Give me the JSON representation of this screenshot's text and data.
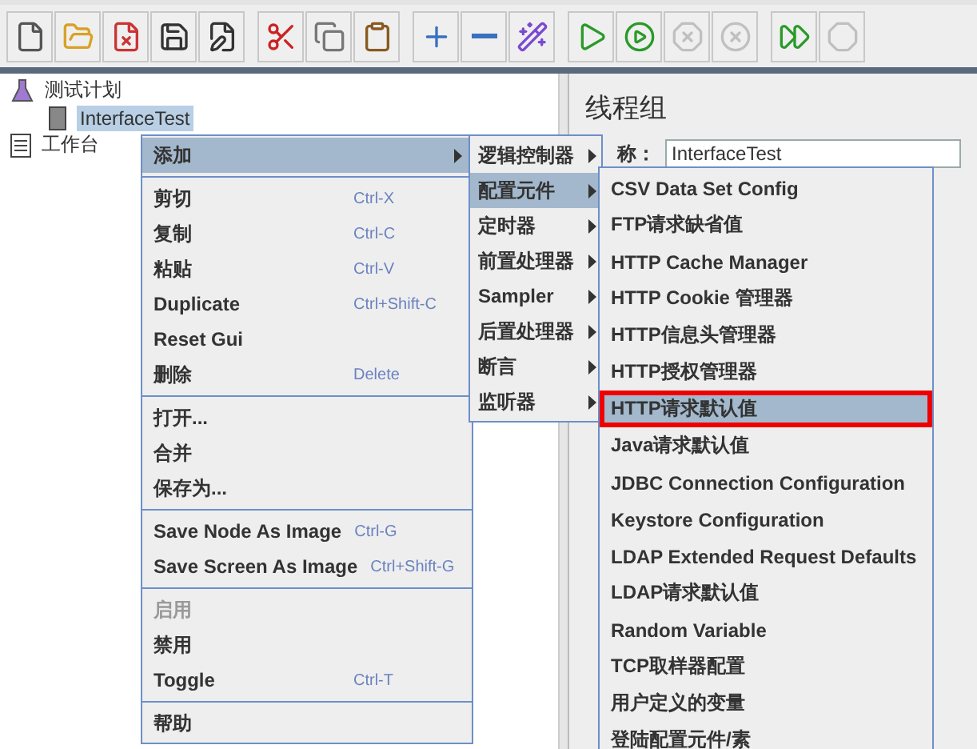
{
  "toolbar": [
    {
      "disabled": false
    },
    {
      "disabled": false
    },
    {
      "disabled": false
    },
    {
      "disabled": false
    },
    {
      "disabled": false
    },
    {
      "disabled": false
    },
    {
      "disabled": false
    },
    {
      "disabled": false
    },
    {
      "disabled": false
    },
    {
      "disabled": false
    },
    {
      "disabled": false
    },
    {
      "disabled": false
    },
    {
      "disabled": false
    },
    {
      "disabled": true
    },
    {
      "disabled": true
    },
    {
      "disabled": false
    },
    {
      "disabled": true
    }
  ],
  "tree": [
    {
      "label": "测试计划",
      "kind": "plan",
      "selected": false,
      "children": [
        {
          "label": "InterfaceTest",
          "kind": "thread",
          "selected": true
        }
      ]
    },
    {
      "label": "工作台",
      "kind": "bench",
      "selected": false
    }
  ],
  "panel": {
    "title": "线程组",
    "name_label": "称：",
    "name_value": "InterfaceTest"
  },
  "context_menu": [
    {
      "kind": "item",
      "label": "添加",
      "submenu": true,
      "selected": true,
      "disabled": false
    },
    {
      "kind": "separator"
    },
    {
      "kind": "item",
      "label": "剪切",
      "shortcut": "Ctrl-X",
      "selected": false,
      "disabled": false
    },
    {
      "kind": "item",
      "label": "复制",
      "shortcut": "Ctrl-C",
      "selected": false,
      "disabled": false
    },
    {
      "kind": "item",
      "label": "粘贴",
      "shortcut": "Ctrl-V",
      "selected": false,
      "disabled": false
    },
    {
      "kind": "item",
      "label": "Duplicate",
      "shortcut": "Ctrl+Shift-C",
      "selected": false,
      "disabled": false
    },
    {
      "kind": "item",
      "label": "Reset Gui",
      "selected": false,
      "disabled": false
    },
    {
      "kind": "item",
      "label": "删除",
      "shortcut": "Delete",
      "selected": false,
      "disabled": false
    },
    {
      "kind": "separator"
    },
    {
      "kind": "item",
      "label": "打开...",
      "selected": false,
      "disabled": false
    },
    {
      "kind": "item",
      "label": "合并",
      "selected": false,
      "disabled": false
    },
    {
      "kind": "item",
      "label": "保存为...",
      "selected": false,
      "disabled": false
    },
    {
      "kind": "separator"
    },
    {
      "kind": "item",
      "label": "Save Node As Image",
      "shortcut": "Ctrl-G",
      "selected": false,
      "disabled": false
    },
    {
      "kind": "item",
      "label": "Save Screen As Image",
      "shortcut": "Ctrl+Shift-G",
      "selected": false,
      "disabled": false
    },
    {
      "kind": "separator"
    },
    {
      "kind": "item",
      "label": "启用",
      "selected": false,
      "disabled": true
    },
    {
      "kind": "item",
      "label": "禁用",
      "selected": false,
      "disabled": false
    },
    {
      "kind": "item",
      "label": "Toggle",
      "shortcut": "Ctrl-T",
      "selected": false,
      "disabled": false
    },
    {
      "kind": "separator"
    },
    {
      "kind": "item",
      "label": "帮助",
      "selected": false,
      "disabled": false
    }
  ],
  "add_menu": [
    {
      "label": "逻辑控制器",
      "selected": false
    },
    {
      "label": "配置元件",
      "selected": true
    },
    {
      "label": "定时器",
      "selected": false
    },
    {
      "label": "前置处理器",
      "selected": false
    },
    {
      "label": "Sampler",
      "selected": false
    },
    {
      "label": "后置处理器",
      "selected": false
    },
    {
      "label": "断言",
      "selected": false
    },
    {
      "label": "监听器",
      "selected": false
    }
  ],
  "config_menu": [
    {
      "label": "CSV Data Set Config",
      "selected": false,
      "outlined": false
    },
    {
      "label": "FTP请求缺省值",
      "selected": false,
      "outlined": false
    },
    {
      "label": "HTTP Cache Manager",
      "selected": false,
      "outlined": false
    },
    {
      "label": "HTTP Cookie 管理器",
      "selected": false,
      "outlined": false
    },
    {
      "label": "HTTP信息头管理器",
      "selected": false,
      "outlined": false
    },
    {
      "label": "HTTP授权管理器",
      "selected": false,
      "outlined": false
    },
    {
      "label": "HTTP请求默认值",
      "selected": true,
      "outlined": true
    },
    {
      "label": "Java请求默认值",
      "selected": false,
      "outlined": false
    },
    {
      "label": "JDBC Connection Configuration",
      "selected": false,
      "outlined": false
    },
    {
      "label": "Keystore Configuration",
      "selected": false,
      "outlined": false
    },
    {
      "label": "LDAP Extended Request Defaults",
      "selected": false,
      "outlined": false
    },
    {
      "label": "LDAP请求默认值",
      "selected": false,
      "outlined": false
    },
    {
      "label": "Random Variable",
      "selected": false,
      "outlined": false
    },
    {
      "label": "TCP取样器配置",
      "selected": false,
      "outlined": false
    },
    {
      "label": "用户定义的变量",
      "selected": false,
      "outlined": false
    },
    {
      "label": "登陆配置元件/素",
      "selected": false,
      "outlined": false
    }
  ]
}
